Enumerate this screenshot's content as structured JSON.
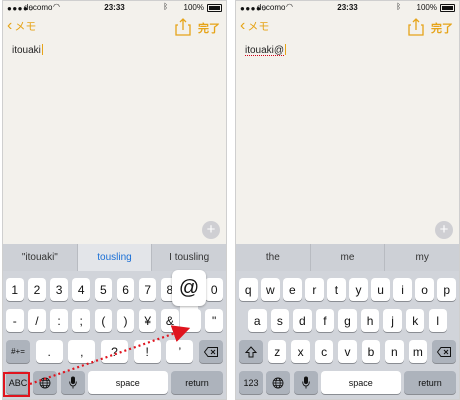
{
  "colors": {
    "accent": "#e6a419",
    "active_suggestion": "#1a6fd6",
    "annotation": "#e0141e"
  },
  "left": {
    "status": {
      "carrier": "docomo",
      "time": "23:33",
      "battery": "100%"
    },
    "nav": {
      "back_label": "メモ",
      "done_label": "完了"
    },
    "note_text": "itouaki",
    "suggestions": [
      "\"itouaki\"",
      "tousling",
      "I tousling"
    ],
    "active_suggestion_index": 1,
    "row1": [
      "1",
      "2",
      "3",
      "4",
      "5",
      "6",
      "7",
      "8",
      "9",
      "0"
    ],
    "row2": [
      "-",
      "/",
      ":",
      ";",
      "(",
      ")",
      "¥",
      "&",
      "@",
      "\""
    ],
    "row3": {
      "mode": "#+=",
      "keys": [
        ".",
        ",",
        "?",
        "!",
        "’"
      ]
    },
    "row4": {
      "abc": "ABC",
      "space": "space",
      "return": "return"
    },
    "popup_char": "@"
  },
  "right": {
    "status": {
      "carrier": "docomo",
      "time": "23:33",
      "battery": "100%"
    },
    "nav": {
      "back_label": "メモ",
      "done_label": "完了"
    },
    "note_text": "itouaki@",
    "suggestions": [
      "the",
      "me",
      "my"
    ],
    "row1": [
      "q",
      "w",
      "e",
      "r",
      "t",
      "y",
      "u",
      "i",
      "o",
      "p"
    ],
    "row2": [
      "a",
      "s",
      "d",
      "f",
      "g",
      "h",
      "j",
      "k",
      "l"
    ],
    "row3": [
      "z",
      "x",
      "c",
      "v",
      "b",
      "n",
      "m"
    ],
    "row4": {
      "num": "123",
      "space": "space",
      "return": "return"
    }
  },
  "icons": [
    "chevron-left-icon",
    "share-icon",
    "plus-icon",
    "globe-icon",
    "microphone-icon",
    "shift-icon",
    "backspace-icon",
    "wifi-icon",
    "bluetooth-icon",
    "battery-icon"
  ]
}
